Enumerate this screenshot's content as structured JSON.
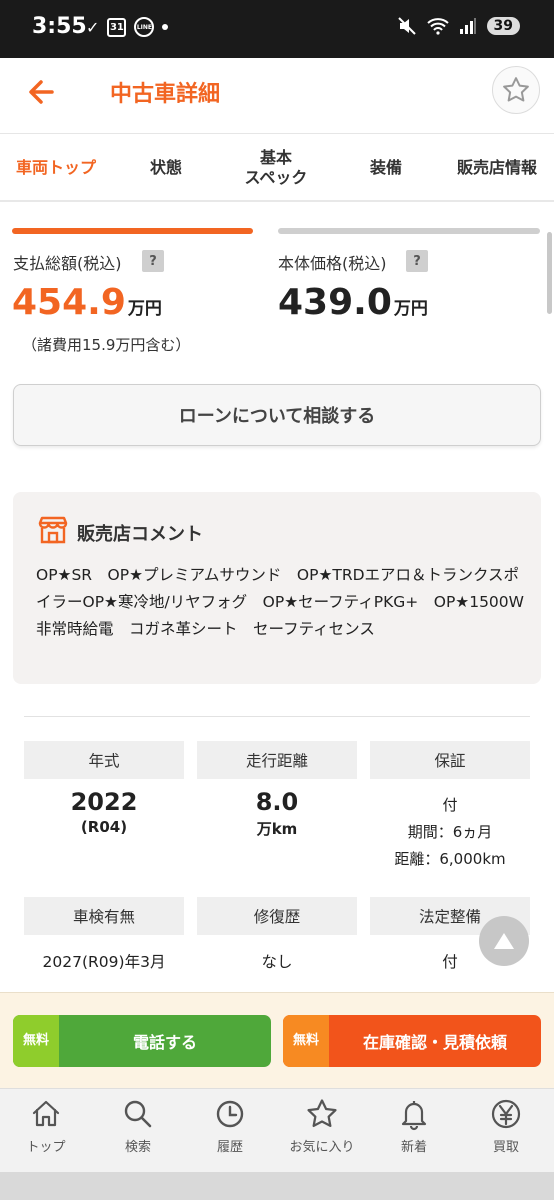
{
  "status_bar": {
    "time": "3:55",
    "calendar": "31",
    "line": "LINE",
    "battery": "39"
  },
  "header": {
    "title": "中古車詳細"
  },
  "tabs": [
    {
      "label": "車両トップ"
    },
    {
      "label": "状態"
    },
    {
      "label_line1": "基本",
      "label_line2": "スペック"
    },
    {
      "label": "装備"
    },
    {
      "label": "販売店情報"
    }
  ],
  "price": {
    "total_label": "支払総額(税込)",
    "total_value": "454.9",
    "total_unit": "万円",
    "fees_note": "（諸費用15.9万円含む）",
    "body_label": "本体価格(税込)",
    "body_value": "439.0",
    "body_unit": "万円",
    "help": "?"
  },
  "loan_button": "ローンについて相談する",
  "comment": {
    "title": "販売店コメント",
    "text": "OP★SR　OP★プレミアムサウンド　OP★TRDエアロ＆トランクスポイラーOP★寒冷地/リヤフォグ　OP★セーフティPKG+　OP★1500W非常時給電　コガネ革シート　セーフティセンス"
  },
  "specs": {
    "year": {
      "label": "年式",
      "value": "2022",
      "sub": "(R04)"
    },
    "mileage": {
      "label": "走行距離",
      "value": "8.0",
      "sub": "万km"
    },
    "warranty": {
      "label": "保証",
      "value": "付",
      "period": "期間：6ヵ月",
      "distance": "距離：6,000km"
    },
    "inspection": {
      "label": "車検有無",
      "value": "2027(R09)年3月"
    },
    "repair": {
      "label": "修復歴",
      "value": "なし"
    },
    "maintenance": {
      "label": "法定整備",
      "value": "付"
    }
  },
  "cta": {
    "free_badge_1": "無料",
    "free_badge_2": "無料",
    "call": "電話する",
    "inquiry": "在庫確認・見積依頼"
  },
  "bottom_nav": [
    {
      "label": "トップ",
      "icon": "home-icon"
    },
    {
      "label": "検索",
      "icon": "search-icon"
    },
    {
      "label": "履歴",
      "icon": "clock-icon"
    },
    {
      "label": "お気に入り",
      "icon": "star-icon"
    },
    {
      "label": "新着",
      "icon": "bell-icon"
    },
    {
      "label": "買取",
      "icon": "yen-icon"
    }
  ],
  "colors": {
    "accent": "#f26522",
    "green": "#4fa83a",
    "cta_bg": "#fcf3e3"
  }
}
